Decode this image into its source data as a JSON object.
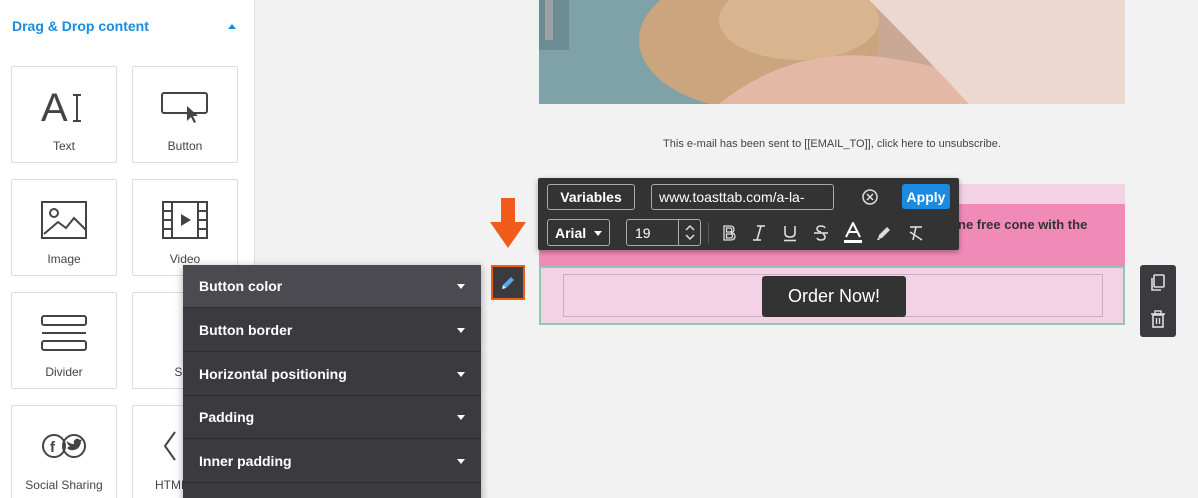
{
  "sidebar": {
    "section_title": "Drag & Drop content",
    "tiles": {
      "text": "Text",
      "button": "Button",
      "image": "Image",
      "video": "Video",
      "divider": "Divider",
      "spacer": "Spa",
      "social": "Social Sharing",
      "html": "HTML"
    }
  },
  "email": {
    "unsubscribe_text": "This e-mail has been sent to [[EMAIL_TO]], click here to unsubscribe.",
    "promo_text_fragment": "ne free cone with the",
    "cta_label": "Order Now!"
  },
  "toolbar": {
    "variables_label": "Variables",
    "url_value": "www.toasttab.com/a-la-mode",
    "apply_label": "Apply",
    "font_family": "Arial",
    "font_size": "19",
    "format_icons": [
      "bold-icon",
      "italic-icon",
      "underline-icon",
      "strikethrough-icon",
      "text-color-icon",
      "highlight-icon",
      "clear-format-icon"
    ]
  },
  "properties": {
    "items": [
      {
        "label": "Button color"
      },
      {
        "label": "Button border"
      },
      {
        "label": "Horizontal positioning"
      },
      {
        "label": "Padding"
      },
      {
        "label": "Inner padding"
      }
    ]
  },
  "colors": {
    "accent": "#1a8be0",
    "panel": "#3a3a3f",
    "highlight_border": "#f05a1a",
    "pink_block": "#f08bb8",
    "pink_light": "#f3d2e6"
  }
}
